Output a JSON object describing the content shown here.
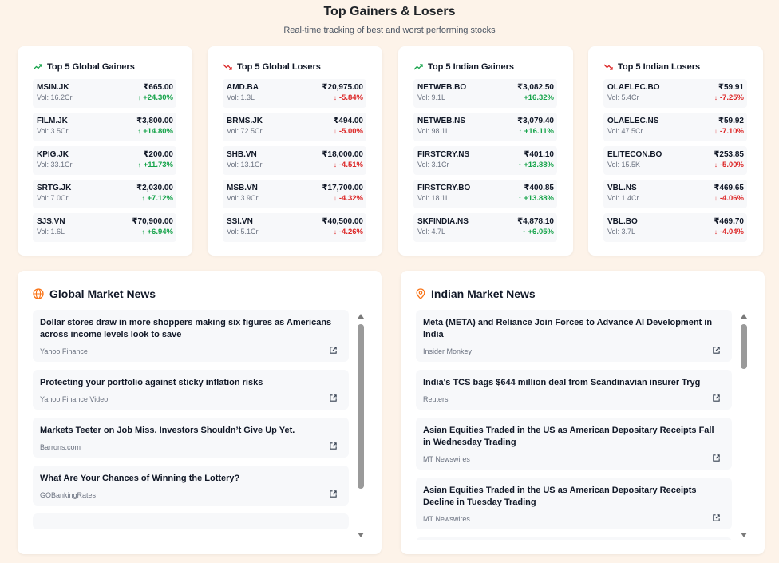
{
  "header": {
    "title": "Top Gainers & Losers",
    "subtitle": "Real-time tracking of best and worst performing stocks"
  },
  "colors": {
    "up": "#16a34a",
    "down": "#dc2626",
    "accent": "#f97316"
  },
  "cards": [
    {
      "title": "Top 5 Global Gainers",
      "trend": "up",
      "rows": [
        {
          "symbol": "MSIN.JK",
          "vol": "Vol: 16.2Cr",
          "price": "₹665.00",
          "change": "+24.30%"
        },
        {
          "symbol": "FILM.JK",
          "vol": "Vol: 3.5Cr",
          "price": "₹3,800.00",
          "change": "+14.80%"
        },
        {
          "symbol": "KPIG.JK",
          "vol": "Vol: 33.1Cr",
          "price": "₹200.00",
          "change": "+11.73%"
        },
        {
          "symbol": "SRTG.JK",
          "vol": "Vol: 7.0Cr",
          "price": "₹2,030.00",
          "change": "+7.12%"
        },
        {
          "symbol": "SJS.VN",
          "vol": "Vol: 1.6L",
          "price": "₹70,900.00",
          "change": "+6.94%"
        }
      ]
    },
    {
      "title": "Top 5 Global Losers",
      "trend": "down",
      "rows": [
        {
          "symbol": "AMD.BA",
          "vol": "Vol: 1.3L",
          "price": "₹20,975.00",
          "change": "-5.84%"
        },
        {
          "symbol": "BRMS.JK",
          "vol": "Vol: 72.5Cr",
          "price": "₹494.00",
          "change": "-5.00%"
        },
        {
          "symbol": "SHB.VN",
          "vol": "Vol: 13.1Cr",
          "price": "₹18,000.00",
          "change": "-4.51%"
        },
        {
          "symbol": "MSB.VN",
          "vol": "Vol: 3.9Cr",
          "price": "₹17,700.00",
          "change": "-4.32%"
        },
        {
          "symbol": "SSI.VN",
          "vol": "Vol: 5.1Cr",
          "price": "₹40,500.00",
          "change": "-4.26%"
        }
      ]
    },
    {
      "title": "Top 5 Indian Gainers",
      "trend": "up",
      "rows": [
        {
          "symbol": "NETWEB.BO",
          "vol": "Vol: 9.1L",
          "price": "₹3,082.50",
          "change": "+16.32%"
        },
        {
          "symbol": "NETWEB.NS",
          "vol": "Vol: 98.1L",
          "price": "₹3,079.40",
          "change": "+16.11%"
        },
        {
          "symbol": "FIRSTCRY.NS",
          "vol": "Vol: 3.1Cr",
          "price": "₹401.10",
          "change": "+13.88%"
        },
        {
          "symbol": "FIRSTCRY.BO",
          "vol": "Vol: 18.1L",
          "price": "₹400.85",
          "change": "+13.88%"
        },
        {
          "symbol": "SKFINDIA.NS",
          "vol": "Vol: 4.7L",
          "price": "₹4,878.10",
          "change": "+6.05%"
        }
      ]
    },
    {
      "title": "Top 5 Indian Losers",
      "trend": "down",
      "rows": [
        {
          "symbol": "OLAELEC.BO",
          "vol": "Vol: 5.4Cr",
          "price": "₹59.91",
          "change": "-7.25%"
        },
        {
          "symbol": "OLAELEC.NS",
          "vol": "Vol: 47.5Cr",
          "price": "₹59.92",
          "change": "-7.10%"
        },
        {
          "symbol": "ELITECON.BO",
          "vol": "Vol: 15.5K",
          "price": "₹253.85",
          "change": "-5.00%"
        },
        {
          "symbol": "VBL.NS",
          "vol": "Vol: 1.4Cr",
          "price": "₹469.65",
          "change": "-4.06%"
        },
        {
          "symbol": "VBL.BO",
          "vol": "Vol: 3.7L",
          "price": "₹469.70",
          "change": "-4.04%"
        }
      ]
    }
  ],
  "global_news": {
    "title": "Global Market News",
    "icon": "globe-icon",
    "items": [
      {
        "headline": "Dollar stores draw in more shoppers making six figures as Americans across income levels look to save",
        "source": "Yahoo Finance"
      },
      {
        "headline": "Protecting your portfolio against sticky inflation risks",
        "source": "Yahoo Finance Video"
      },
      {
        "headline": "Markets Teeter on Job Miss. Investors Shouldn’t Give Up Yet.",
        "source": "Barrons.com"
      },
      {
        "headline": "What Are Your Chances of Winning the Lottery?",
        "source": "GOBankingRates"
      }
    ]
  },
  "indian_news": {
    "title": "Indian Market News",
    "icon": "location-pin-icon",
    "items": [
      {
        "headline": "Meta (META) and Reliance Join Forces to Advance AI Development in India",
        "source": "Insider Monkey"
      },
      {
        "headline": "India's TCS bags $644 million deal from Scandinavian insurer Tryg",
        "source": "Reuters"
      },
      {
        "headline": "Asian Equities Traded in the US as American Depositary Receipts Fall in Wednesday Trading",
        "source": "MT Newswires"
      },
      {
        "headline": "Asian Equities Traded in the US as American Depositary Receipts Decline in Tuesday Trading",
        "source": "MT Newswires"
      }
    ]
  }
}
